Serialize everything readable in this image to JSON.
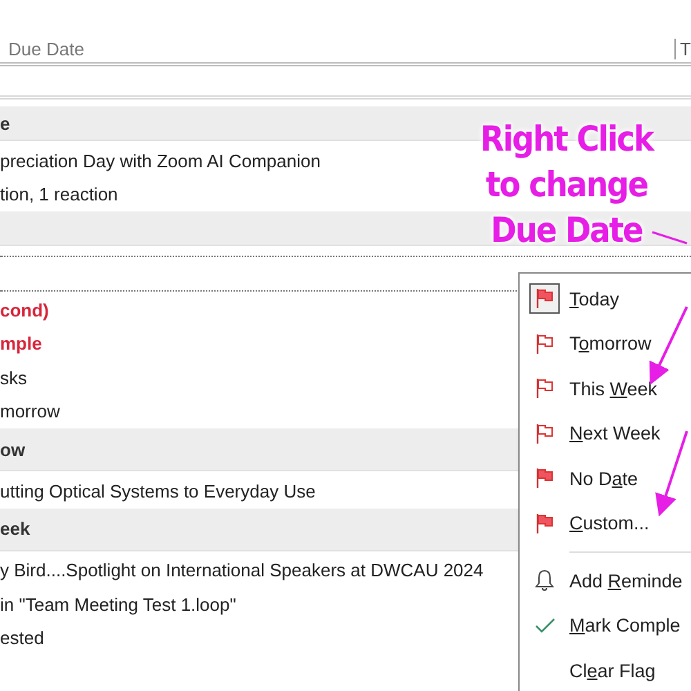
{
  "columns": [
    {
      "label": "Due Date"
    },
    {
      "label": "T"
    }
  ],
  "list": [
    {
      "kind": "filter"
    },
    {
      "kind": "group",
      "label": "e"
    },
    {
      "kind": "item",
      "label": "preciation Day with Zoom AI Companion",
      "overdue": false
    },
    {
      "kind": "item",
      "label": "tion, 1 reaction",
      "overdue": false
    },
    {
      "kind": "group"
    },
    {
      "kind": "focus"
    },
    {
      "kind": "item",
      "label": "cond)",
      "overdue": true
    },
    {
      "kind": "item",
      "label": "mple",
      "overdue": true
    },
    {
      "kind": "item",
      "label": "sks",
      "overdue": false
    },
    {
      "kind": "item",
      "label": "morrow",
      "overdue": false
    },
    {
      "kind": "group",
      "label": "ow"
    },
    {
      "kind": "item",
      "label": "utting Optical Systems to Everyday Use",
      "overdue": false
    },
    {
      "kind": "group",
      "label": "eek"
    },
    {
      "kind": "item",
      "label": "y Bird....Spotlight on International Speakers at DWCAU 2024",
      "overdue": false
    },
    {
      "kind": "item",
      "label": "in \"Team Meeting Test 1.loop\"",
      "overdue": false
    },
    {
      "kind": "item",
      "label": "ested",
      "overdue": false
    }
  ],
  "menu": [
    {
      "kind": "flag",
      "key": "T",
      "after": "oday",
      "current": true,
      "filled": true
    },
    {
      "kind": "flag",
      "before": "T",
      "key": "o",
      "after": "morrow",
      "current": false,
      "filled": false
    },
    {
      "kind": "flag",
      "before": "This ",
      "key": "W",
      "after": "eek",
      "current": false,
      "filled": false
    },
    {
      "kind": "flag",
      "key": "N",
      "after": "ext Week",
      "current": false,
      "filled": false
    },
    {
      "kind": "flag",
      "before": "No D",
      "key": "a",
      "after": "te",
      "current": false,
      "filled": true
    },
    {
      "kind": "flag",
      "key": "C",
      "after": "ustom...",
      "current": false,
      "filled": true
    },
    {
      "kind": "divider"
    },
    {
      "kind": "bell",
      "before": "Add ",
      "key": "R",
      "after": "eminde"
    },
    {
      "kind": "check",
      "key": "M",
      "after": "ark Comple"
    },
    {
      "kind": "plain",
      "before": "Cl",
      "key": "e",
      "after": "ar Flag"
    }
  ],
  "annotation": {
    "lines": [
      "Right Click",
      "to change",
      "Due Date"
    ]
  }
}
